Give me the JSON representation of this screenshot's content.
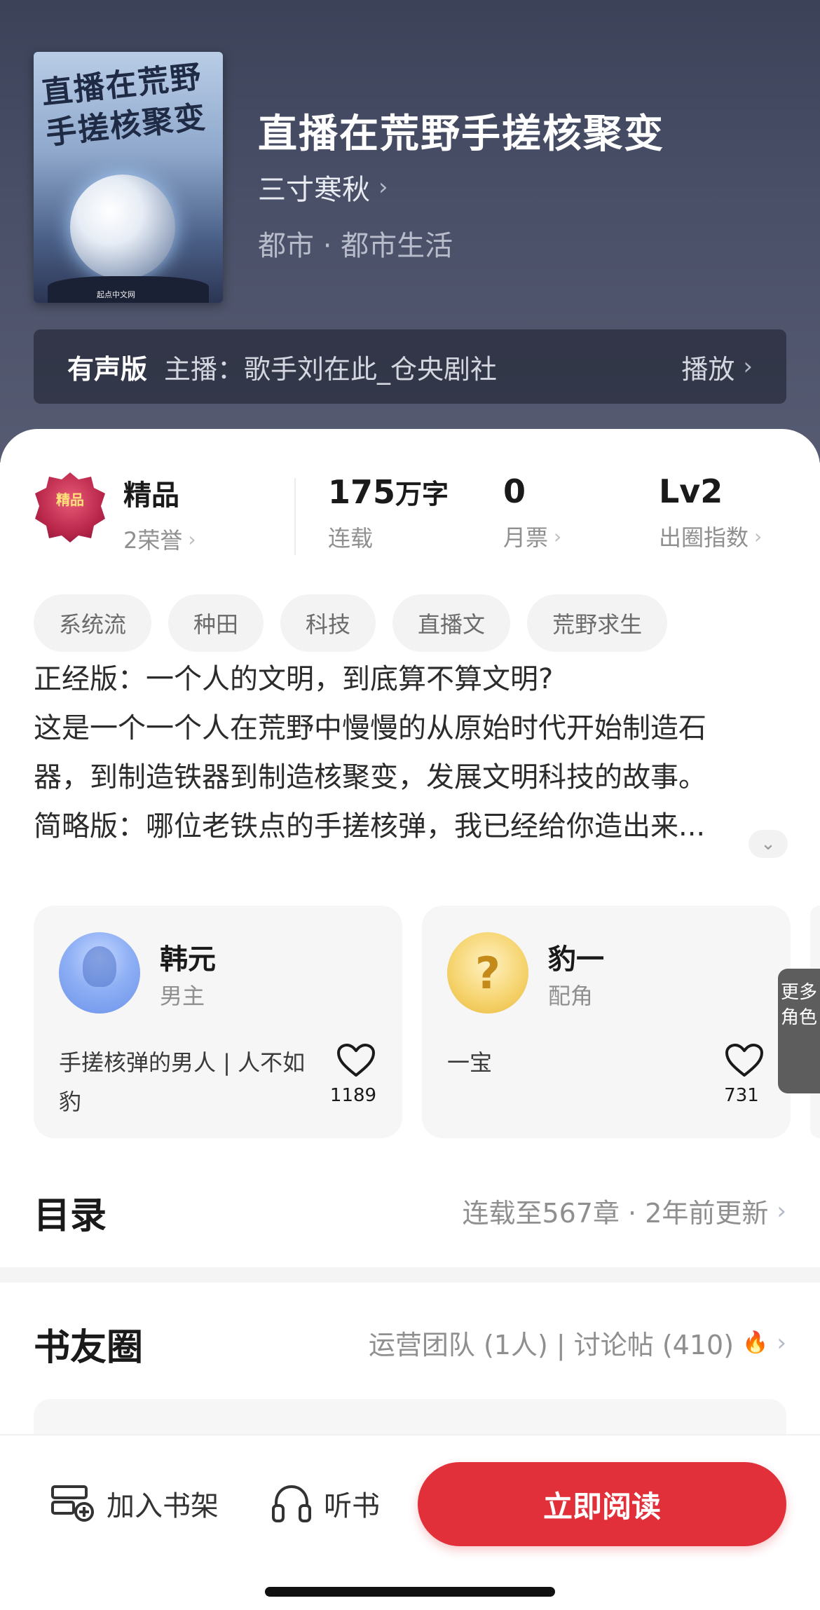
{
  "book": {
    "title": "直播在荒野手搓核聚变",
    "author": "三寸寒秋",
    "category": "都市 · 都市生活",
    "cover_title": "直播在荒野手搓核聚变",
    "cover_publisher": "起点中文网"
  },
  "audio": {
    "label": "有声版",
    "host": "主播：歌手刘在此_仓央剧社",
    "play": "播放"
  },
  "stats": {
    "badge_text": "精品",
    "honor_title": "精品",
    "honor_sub": "2荣誉",
    "words_value": "175",
    "words_unit": "万字",
    "words_sub": "连载",
    "monthly_value": "0",
    "monthly_sub": "月票",
    "level_value": "Lv2",
    "level_sub": "出圈指数"
  },
  "tags": [
    "系统流",
    "种田",
    "科技",
    "直播文",
    "荒野求生"
  ],
  "description": {
    "line1": "正经版：一个人的文明，到底算不算文明?",
    "line2": "这是一个一个人在荒野中慢慢的从原始时代开始制造石",
    "line3": "器，到制造铁器到制造核聚变，发展文明科技的故事。",
    "line4": "简略版：哪位老铁点的手搓核弹，我已经给你造出来..."
  },
  "characters": [
    {
      "name": "韩元",
      "role": "男主",
      "desc": "手搓核弹的男人 | 人不如豹",
      "likes": "1189"
    },
    {
      "name": "豹一",
      "role": "配角",
      "desc": "一宝",
      "likes": "731"
    }
  ],
  "more_roles": "更多角色",
  "catalog": {
    "title": "目录",
    "status": "连载至567章 · 2年前更新"
  },
  "circle": {
    "title": "书友圈",
    "info": "运营团队 (1人) | 讨论帖 (410)"
  },
  "bottom": {
    "shelf": "加入书架",
    "listen": "听书",
    "read": "立即阅读"
  },
  "colors": {
    "accent": "#e2303a",
    "header_bg": "#474d64"
  },
  "icons": {
    "chevron": "chevron-right-icon",
    "heart": "heart-icon",
    "shelf": "shelf-add-icon",
    "headphones": "headphones-icon",
    "fire": "fire-icon"
  }
}
